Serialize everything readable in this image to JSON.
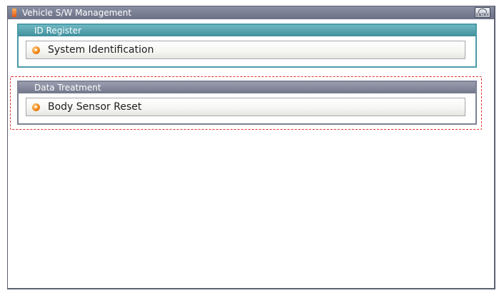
{
  "window": {
    "title": "Vehicle S/W Management",
    "help_button_label": "ENTRY"
  },
  "groups": [
    {
      "header": "ID Register",
      "items": [
        {
          "label": "System Identification"
        }
      ]
    },
    {
      "header": "Data Treatment",
      "items": [
        {
          "label": "Body Sensor Reset"
        }
      ]
    }
  ],
  "colors": {
    "titlebar": "#7a7f94",
    "id_register_header": "#4a9ba8",
    "data_treatment_header": "#7c8194",
    "selection_outline": "#e23030",
    "bullet": "#f08a18"
  },
  "icons": {
    "title": "window-app-icon",
    "help": "help-entry-icon",
    "item_bullet": "orange-arrow-bullet-icon"
  }
}
